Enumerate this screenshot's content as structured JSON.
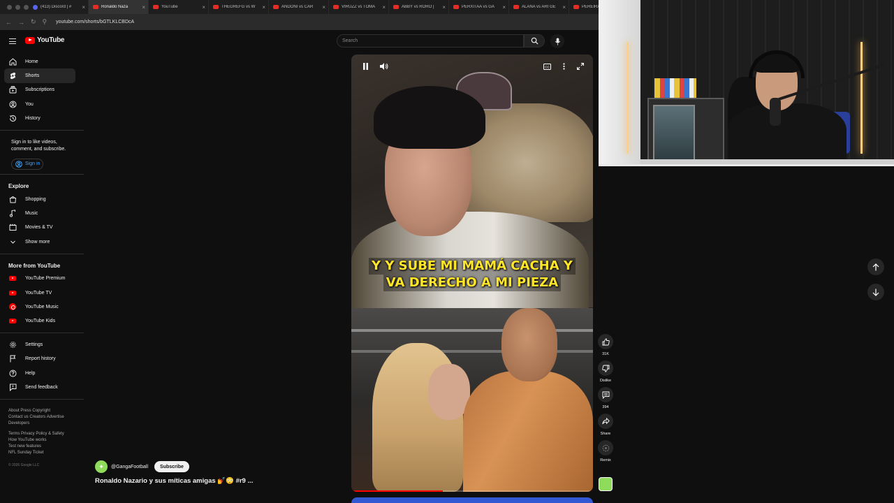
{
  "browser": {
    "tabs": [
      {
        "label": "(413) Discord | #",
        "type": "discord"
      },
      {
        "label": "Ronaldo Naza",
        "type": "yt",
        "active": true
      },
      {
        "label": "YouTube",
        "type": "yt"
      },
      {
        "label": "THEGREFG vs W",
        "type": "yt"
      },
      {
        "label": "ANDONI vs CAR",
        "type": "yt"
      },
      {
        "label": "VIRUZZ vs TOMA",
        "type": "yt"
      },
      {
        "label": "ABBY vs RORO |",
        "type": "yt"
      },
      {
        "label": "PERXITAA vs GA",
        "type": "yt"
      },
      {
        "label": "ALANA vs ARI GE",
        "type": "yt"
      },
      {
        "label": "PEREIRA v",
        "type": "yt"
      }
    ],
    "url": "youtube.com/shorts/bGTLKLCBDcA"
  },
  "masthead": {
    "logo_text": "YouTube",
    "search_placeholder": "Search"
  },
  "sidebar": {
    "main": [
      {
        "label": "Home",
        "icon": "home-icon"
      },
      {
        "label": "Shorts",
        "icon": "shorts-icon",
        "active": true
      },
      {
        "label": "Subscriptions",
        "icon": "subscriptions-icon"
      },
      {
        "label": "You",
        "icon": "you-icon"
      },
      {
        "label": "History",
        "icon": "history-icon"
      }
    ],
    "signin_text": "Sign in to like videos, comment, and subscribe.",
    "signin_button": "Sign in",
    "explore_heading": "Explore",
    "explore": [
      {
        "label": "Shopping",
        "icon": "shopping-icon"
      },
      {
        "label": "Music",
        "icon": "music-icon"
      },
      {
        "label": "Movies & TV",
        "icon": "movies-icon"
      },
      {
        "label": "Show more",
        "icon": "chevron-down-icon"
      }
    ],
    "more_heading": "More from YouTube",
    "more": [
      {
        "label": "YouTube Premium"
      },
      {
        "label": "YouTube TV"
      },
      {
        "label": "YouTube Music"
      },
      {
        "label": "YouTube Kids"
      }
    ],
    "settings": [
      {
        "label": "Settings",
        "icon": "gear-icon"
      },
      {
        "label": "Report history",
        "icon": "flag-icon"
      },
      {
        "label": "Help",
        "icon": "help-icon"
      },
      {
        "label": "Send feedback",
        "icon": "feedback-icon"
      }
    ],
    "footer": {
      "line1": "About  Press  Copyright",
      "line2": "Contact us  Creators  Advertise",
      "line3": "Developers",
      "line4": "Terms  Privacy  Policy & Safety",
      "line5": "How YouTube works",
      "line6": "Test new features",
      "line7": "NFL Sunday Ticket",
      "copyright": "© 2026 Google LLC"
    }
  },
  "short": {
    "caption_line1": "Y Y SUBE MI MAMÁ CACHA Y",
    "caption_line2": "VA DERECHO A MI PIEZA",
    "progress": 0.38,
    "channel_handle": "@GangaFootball",
    "subscribe_label": "Subscribe",
    "title": "Ronaldo Nazario y sus míticas amigas 💅😳 #r9 ..."
  },
  "actions": {
    "like_count": "31K",
    "dislike_label": "Dislike",
    "comment_count": "394",
    "share_label": "Share",
    "remix_label": "Remix"
  }
}
